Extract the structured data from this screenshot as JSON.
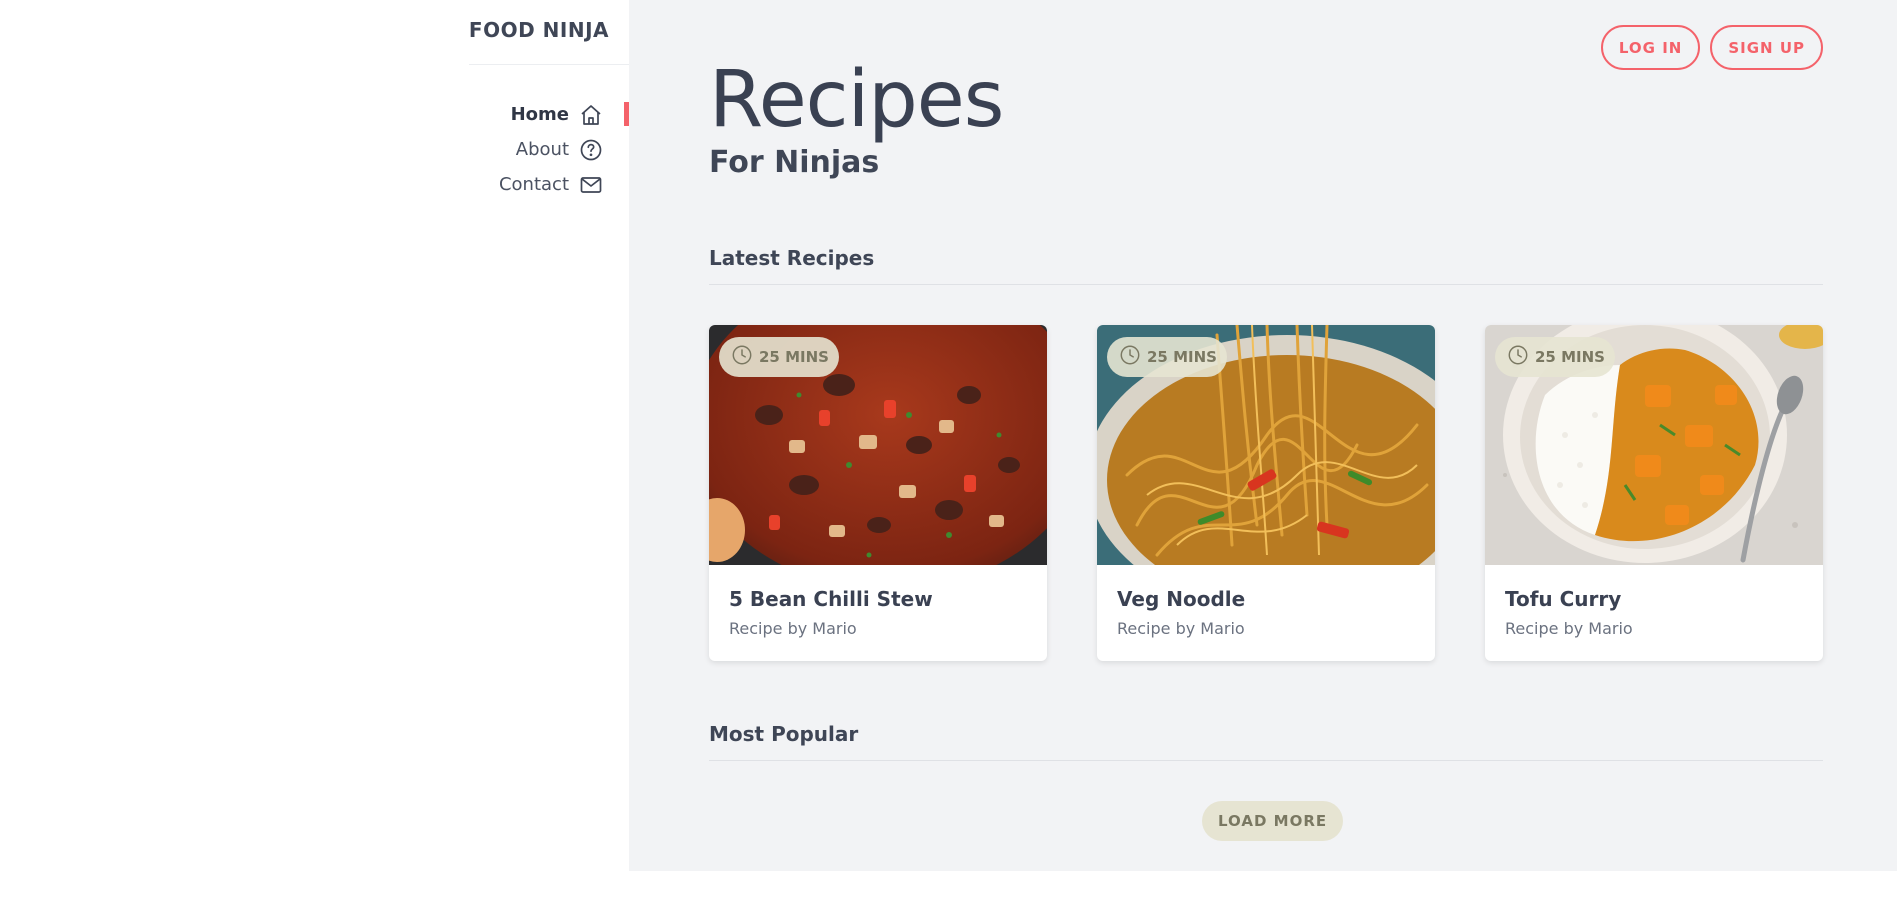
{
  "sidebar": {
    "brand": "FOOD NINJA",
    "nav": [
      {
        "label": "Home",
        "icon": "home-icon",
        "active": true
      },
      {
        "label": "About",
        "icon": "help-circle-icon",
        "active": false
      },
      {
        "label": "Contact",
        "icon": "mail-icon",
        "active": false
      }
    ]
  },
  "header": {
    "login_label": "LOG IN",
    "signup_label": "SIGN UP",
    "title": "Recipes",
    "subtitle": "For Ninjas"
  },
  "sections": {
    "latest": "Latest Recipes",
    "popular": "Most Popular"
  },
  "recipes": [
    {
      "title": "5 Bean Chilli Stew",
      "author": "Recipe by Mario",
      "time": "25 MINS"
    },
    {
      "title": "Veg Noodle",
      "author": "Recipe by Mario",
      "time": "25 MINS"
    },
    {
      "title": "Tofu Curry",
      "author": "Recipe by Mario",
      "time": "25 MINS"
    }
  ],
  "load_more_label": "LOAD MORE",
  "colors": {
    "accent": "#f4626a",
    "text": "#3f4656",
    "main_bg": "#f2f3f5",
    "badge_bg": "#e6e4d2"
  }
}
